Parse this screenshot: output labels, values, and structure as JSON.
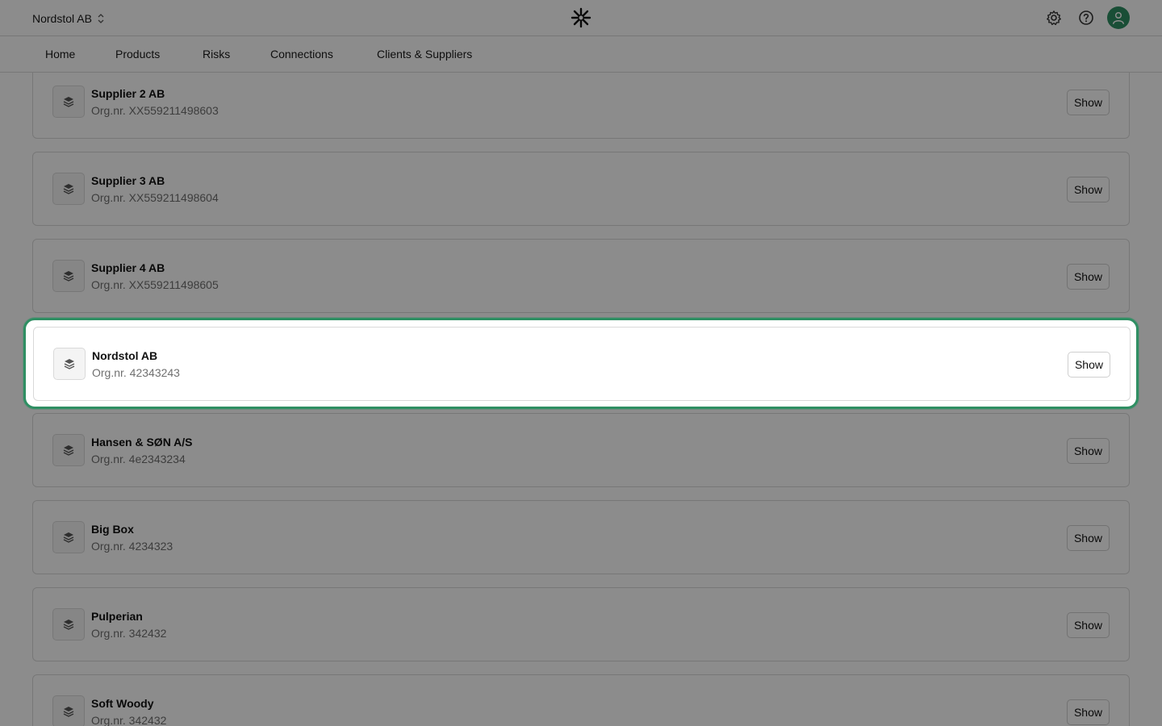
{
  "topbar": {
    "company": "Nordstol AB",
    "icons": [
      "sort-chevrons-icon",
      "logo-icon",
      "gear-icon",
      "help-icon",
      "user-icon"
    ]
  },
  "nav": {
    "items": [
      {
        "label": "Home"
      },
      {
        "label": "Products"
      },
      {
        "label": "Risks"
      },
      {
        "label": "Connections"
      },
      {
        "label": "Clients & Suppliers"
      }
    ]
  },
  "companies": [
    {
      "name": "Supplier 2 AB",
      "org": "Org.nr. XX559211498603",
      "button": "Show"
    },
    {
      "name": "Supplier 3 AB",
      "org": "Org.nr. XX559211498604",
      "button": "Show"
    },
    {
      "name": "Supplier 4 AB",
      "org": "Org.nr. XX559211498605",
      "button": "Show"
    },
    {
      "name": "Nordstol AB",
      "org": "Org.nr. 42343243",
      "button": "Show",
      "highlighted": true
    },
    {
      "name": "Hansen & SØN A/S",
      "org": "Org.nr. 4e2343234",
      "button": "Show"
    },
    {
      "name": "Big Box",
      "org": "Org.nr. 4234323",
      "button": "Show"
    },
    {
      "name": "Pulperian",
      "org": "Org.nr. 342432",
      "button": "Show"
    },
    {
      "name": "Soft Woody",
      "org": "Org.nr. 342432",
      "button": "Show"
    }
  ],
  "colors": {
    "accent": "#2f8f63",
    "overlay": "rgba(0,0,0,0.45)"
  }
}
